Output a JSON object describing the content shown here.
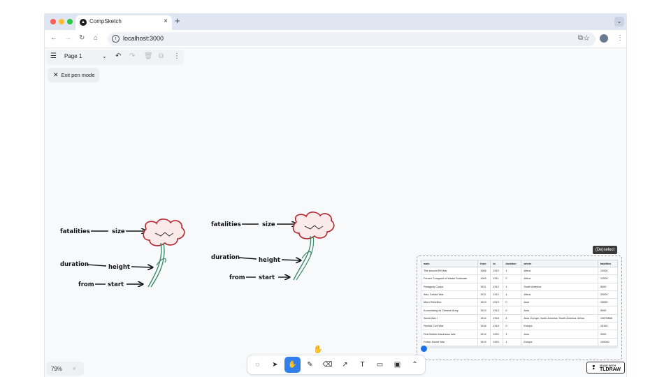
{
  "browser": {
    "tab_title": "CompSketch",
    "url": "localhost:3000",
    "new_tab": "+",
    "close_tab": "×"
  },
  "app": {
    "page_name": "Page 1",
    "exit_pen_label": "Exit pen mode",
    "zoom": "79%",
    "selection_label": "(De)select",
    "made_with": "MADE WITH",
    "made_with_brand": "TLDRAW"
  },
  "sketch1": {
    "labels": [
      "fatalities",
      "size",
      "duration",
      "height",
      "from",
      "start"
    ]
  },
  "sketch2": {
    "labels": [
      "fatalities",
      "size",
      "duration",
      "height",
      "from",
      "start"
    ]
  },
  "table": {
    "columns": [
      "wars",
      "from",
      "to",
      "duration",
      "where",
      "fatalities"
    ],
    "rows": [
      [
        "The second Rif War",
        "1908",
        "1910",
        "1",
        "Africa",
        "10000"
      ],
      [
        "French Conquest of Wadai Sultanate",
        "1909",
        "1911",
        "2",
        "Africa",
        "12000"
      ],
      [
        "Paraguay Coups",
        "1911",
        "1912",
        "1",
        "South America",
        "5000"
      ],
      [
        "Italo-Turkish War",
        "1911",
        "1912",
        "1",
        "Africa",
        "20000"
      ],
      [
        "Moro Rebellion",
        "1913",
        "1913",
        "0",
        "Asia",
        "15050"
      ],
      [
        "Kuomintang vs Chinese Army",
        "1913",
        "1913",
        "0",
        "Asia",
        "5000"
      ],
      [
        "World War I",
        "1914",
        "1918",
        "4",
        "Asia, Europe, North America, South America, Africa",
        "10670868"
      ],
      [
        "Finnish Civil War",
        "1918",
        "1918",
        "0",
        "Europe",
        "15150"
      ],
      [
        "First British-Waziristan War",
        "1919",
        "1920",
        "1",
        "Asia",
        "2000"
      ],
      [
        "Polish-Soviet War",
        "1919",
        "1920",
        "1",
        "Europe",
        "100000"
      ]
    ]
  },
  "toolbar": {
    "tools": [
      "lasso-icon",
      "select-icon",
      "hand-icon",
      "pencil-icon",
      "eraser-icon",
      "arrow-icon",
      "text-icon",
      "note-icon",
      "image-icon",
      "chevron-up-icon"
    ],
    "active": "hand-icon",
    "accent": "#2f80ed"
  }
}
